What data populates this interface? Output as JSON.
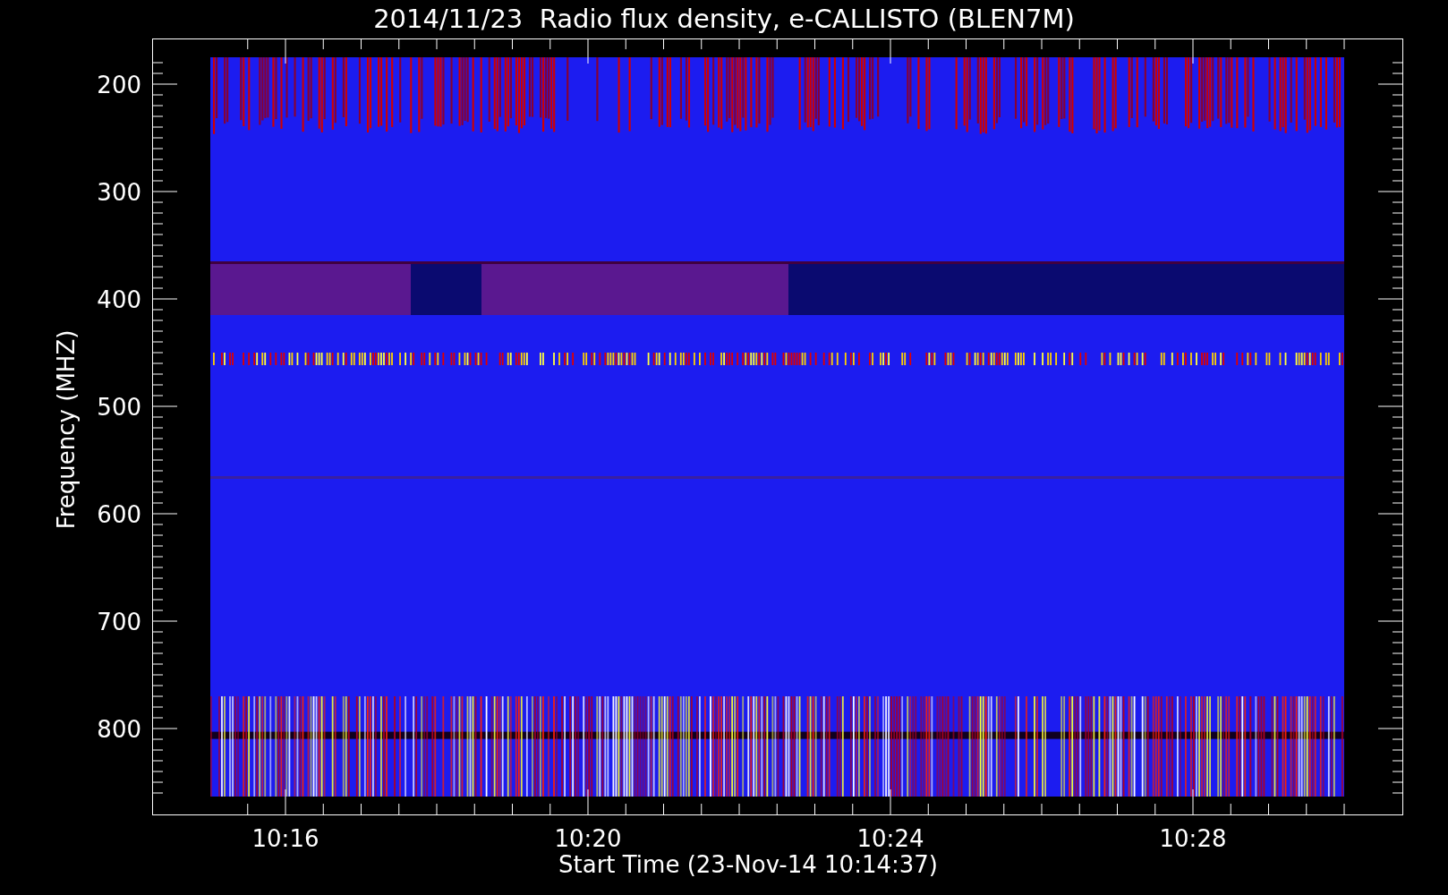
{
  "plot": {
    "title": "2014/11/23  Radio flux density, e-CALLISTO (BLEN7M)",
    "ylabel": "Frequency (MHZ)",
    "xlabel": "Start Time (23-Nov-14 10:14:37)",
    "yticks": [
      "200",
      "300",
      "400",
      "500",
      "600",
      "700",
      "800"
    ],
    "xticks": [
      "10:16",
      "10:20",
      "10:24",
      "10:28"
    ]
  }
}
